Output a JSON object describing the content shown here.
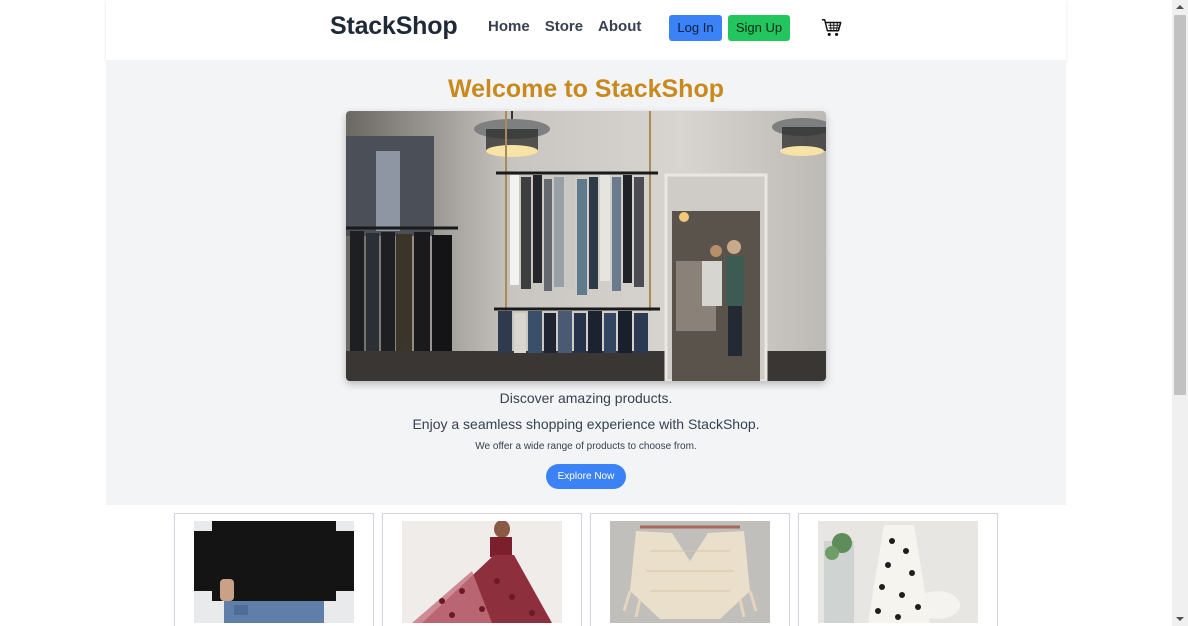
{
  "nav": {
    "brand": "StackShop",
    "links": [
      "Home",
      "Store",
      "About"
    ],
    "login_label": "Log In",
    "signup_label": "Sign Up",
    "cart_icon": "cart-icon"
  },
  "hero": {
    "title": "Welcome to StackShop",
    "image": "clothing-store-interior",
    "line1": "Discover amazing products.",
    "line2": "Enjoy a seamless shopping experience with StackShop.",
    "line3": "We offer a wide range of products to choose from.",
    "cta_label": "Explore Now"
  },
  "products": [
    {
      "image": "black-tshirt-jeans"
    },
    {
      "image": "red-tulle-gown"
    },
    {
      "image": "cream-knit-poncho"
    },
    {
      "image": "floral-white-dress"
    }
  ],
  "colors": {
    "title_accent": "#c88a1e",
    "primary": "#3b82f6",
    "success": "#22c55e",
    "hero_bg": "#f3f4f6"
  }
}
